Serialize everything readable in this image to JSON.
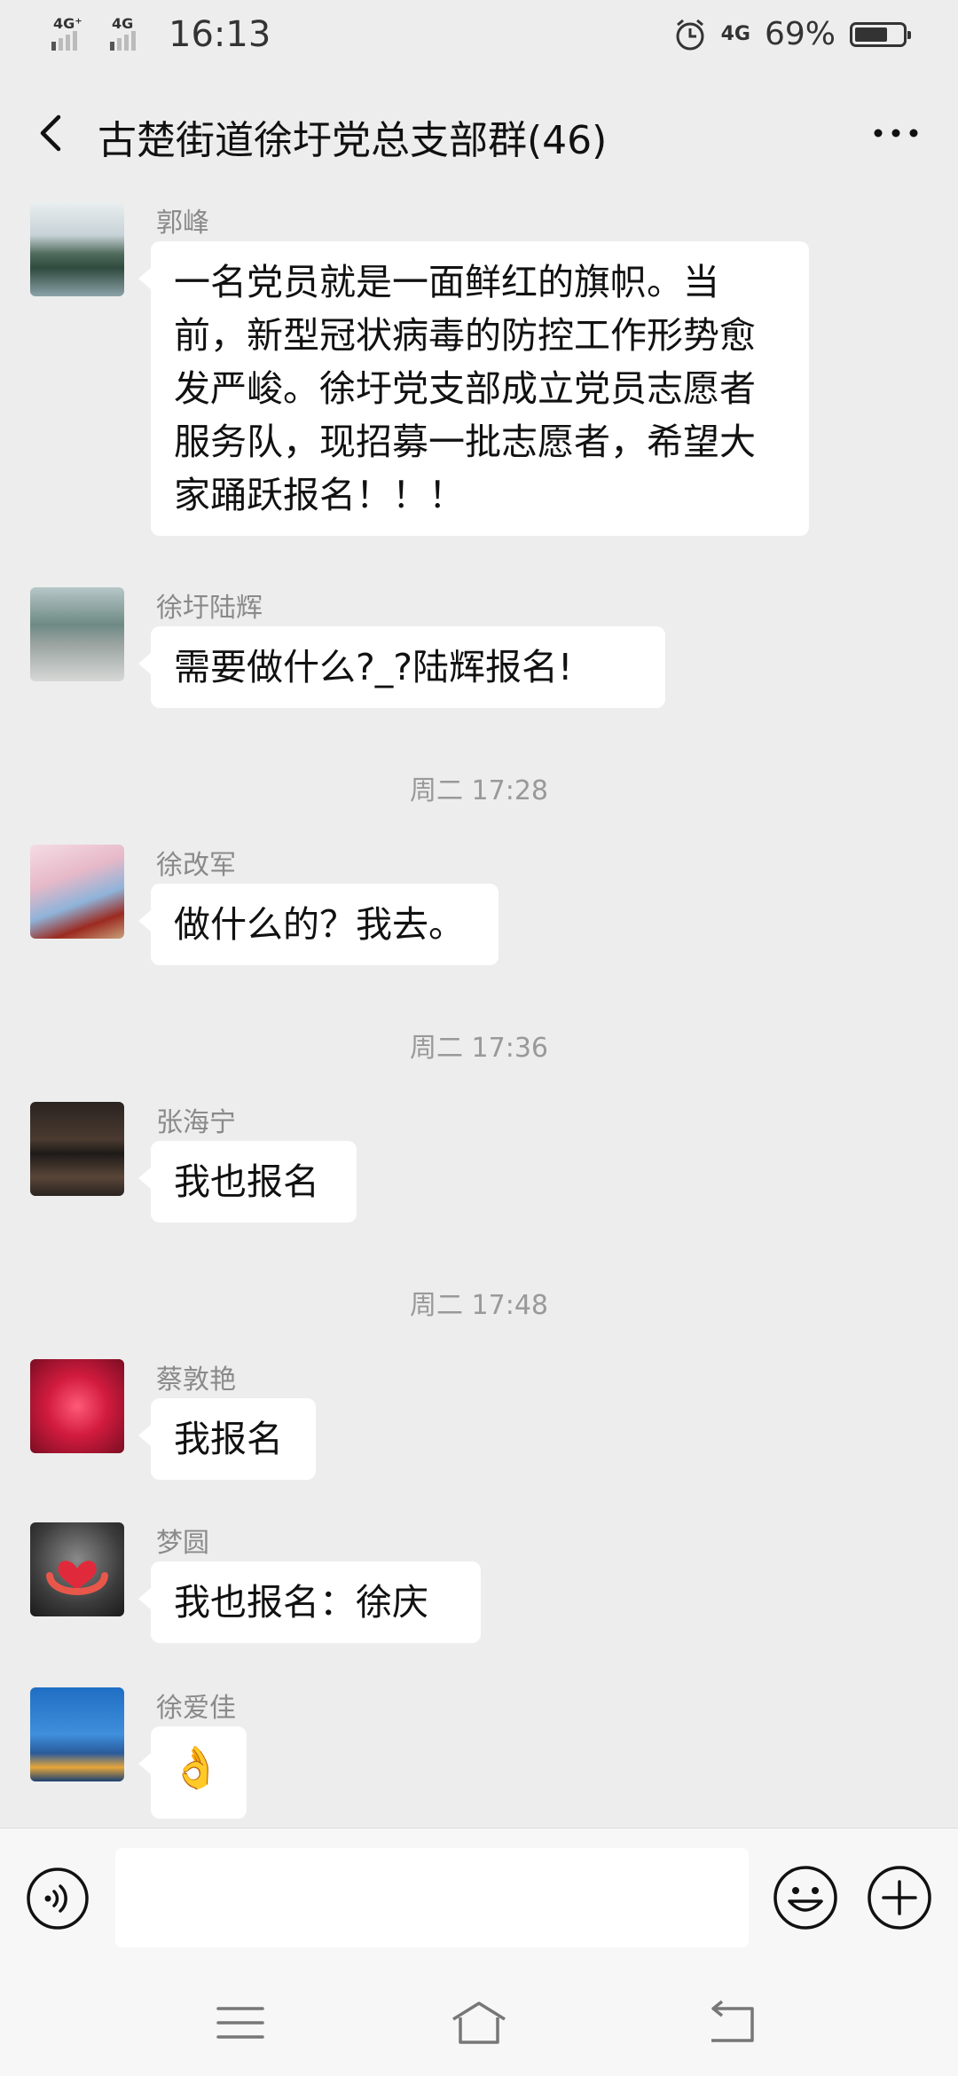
{
  "status": {
    "net1": "4G⁺",
    "net2": "4G",
    "time": "16:13",
    "net3": "4G",
    "battery": "69%",
    "battery_level": 0.69
  },
  "header": {
    "title": "古楚街道徐圩党总支部群(46)"
  },
  "messages": [
    {
      "sender": "郭峰",
      "text": "一名党员就是一面鲜红的旗帜。当前，新型冠状病毒的防控工作形势愈发严峻。徐圩党支部成立党员志愿者服务队，现招募一批志愿者，希望大家踊跃报名！！！"
    },
    {
      "sender": "徐圩陆辉",
      "text": "需要做什么?_?陆辉报名!"
    },
    {
      "time": "周二 17:28"
    },
    {
      "sender": "徐改军",
      "text": "做什么的？我去。"
    },
    {
      "time": "周二 17:36"
    },
    {
      "sender": "张海宁",
      "text": "我也报名"
    },
    {
      "time": "周二 17:48"
    },
    {
      "sender": "蔡敦艳",
      "text": "我报名"
    },
    {
      "sender": "梦圆",
      "text": "我也报名：徐庆"
    },
    {
      "sender": "徐爱佳",
      "text": "👌"
    }
  ],
  "icons": {
    "back": "back-arrow-icon",
    "more": "more-dots-icon",
    "voice": "voice-icon",
    "emoji": "emoji-icon",
    "plus": "plus-icon",
    "menu": "menu-icon",
    "home": "home-icon",
    "back_nav": "return-icon"
  }
}
